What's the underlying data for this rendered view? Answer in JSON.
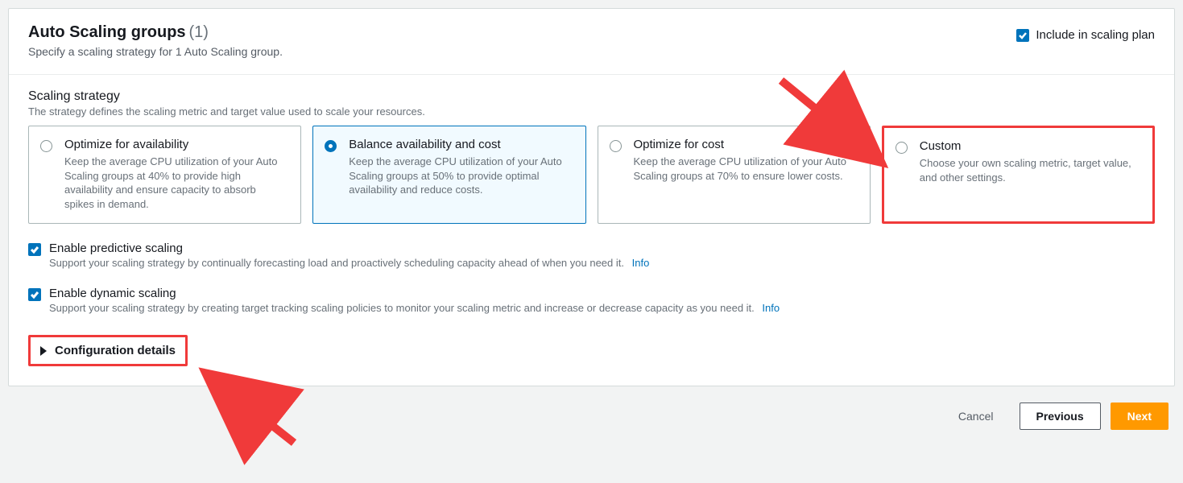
{
  "header": {
    "title": "Auto Scaling groups",
    "count": "(1)",
    "subtitle": "Specify a scaling strategy for 1 Auto Scaling group.",
    "include_label": "Include in scaling plan"
  },
  "strategy": {
    "label": "Scaling strategy",
    "desc": "The strategy defines the scaling metric and target value used to scale your resources.",
    "cards": [
      {
        "title": "Optimize for availability",
        "desc": "Keep the average CPU utilization of your Auto Scaling groups at 40% to provide high availability and ensure capacity to absorb spikes in demand."
      },
      {
        "title": "Balance availability and cost",
        "desc": "Keep the average CPU utilization of your Auto Scaling groups at 50% to provide optimal availability and reduce costs."
      },
      {
        "title": "Optimize for cost",
        "desc": "Keep the average CPU utilization of your Auto Scaling groups at 70% to ensure lower costs."
      },
      {
        "title": "Custom",
        "desc": "Choose your own scaling metric, target value, and other settings."
      }
    ]
  },
  "predictive": {
    "label": "Enable predictive scaling",
    "desc": "Support your scaling strategy by continually forecasting load and proactively scheduling capacity ahead of when you need it.",
    "info": "Info"
  },
  "dynamic": {
    "label": "Enable dynamic scaling",
    "desc": "Support your scaling strategy by creating target tracking scaling policies to monitor your scaling metric and increase or decrease capacity as you need it.",
    "info": "Info"
  },
  "config_details": "Configuration details",
  "footer": {
    "cancel": "Cancel",
    "previous": "Previous",
    "next": "Next"
  }
}
